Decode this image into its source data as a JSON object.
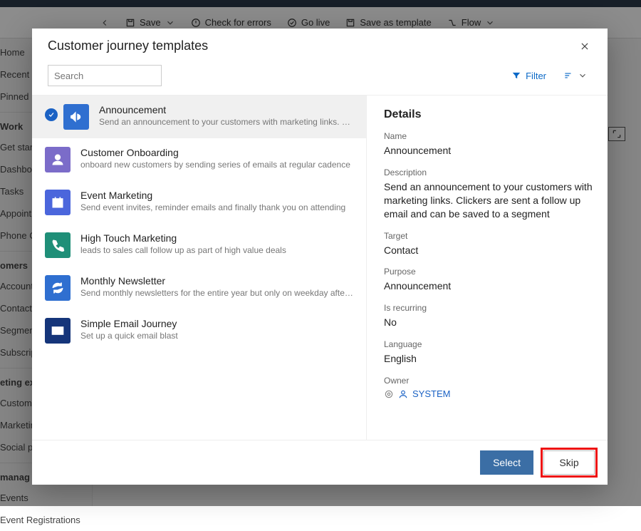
{
  "bg": {
    "cmd": {
      "save": "Save",
      "checkErrors": "Check for errors",
      "goLive": "Go live",
      "saveTemplate": "Save as template",
      "flow": "Flow"
    },
    "nav": {
      "home": "Home",
      "recent": "Recent",
      "pinned": "Pinned",
      "groupWork": "Work",
      "getStart": "Get start",
      "dashboard": "Dashboa",
      "tasks": "Tasks",
      "appoint": "Appoint",
      "phone": "Phone C",
      "groupCustomers": "omers",
      "accounts": "Account",
      "contacts": "Contacts",
      "segments": "Segmen",
      "subscrip": "Subscrip",
      "groupMarketingEx": "eting ex",
      "customer": "Custome",
      "marketin": "Marketin",
      "socialpo": "Social po",
      "groupManage": "manag",
      "events": "Events",
      "eventreg": "Event Registrations"
    }
  },
  "modal": {
    "title": "Customer journey templates",
    "searchPlaceholder": "Search",
    "filterLabel": "Filter",
    "details": {
      "heading": "Details",
      "nameLabel": "Name",
      "name": "Announcement",
      "descLabel": "Description",
      "desc": "Send an announcement to your customers with marketing links. Clickers are sent a follow up email and can be saved to a segment",
      "targetLabel": "Target",
      "target": "Contact",
      "purposeLabel": "Purpose",
      "purpose": "Announcement",
      "recurringLabel": "Is recurring",
      "recurring": "No",
      "languageLabel": "Language",
      "language": "English",
      "ownerLabel": "Owner",
      "owner": "SYSTEM"
    },
    "templates": [
      {
        "title": "Announcement",
        "desc": "Send an announcement to your customers with marketing links. Clickers are sent a…",
        "color": "#2f6fd0",
        "icon": "megaphone",
        "selected": true
      },
      {
        "title": "Customer Onboarding",
        "desc": "onboard new customers by sending series of emails at regular cadence",
        "color": "#7b6cc9",
        "icon": "person"
      },
      {
        "title": "Event Marketing",
        "desc": "Send event invites, reminder emails and finally thank you on attending",
        "color": "#4b66dc",
        "icon": "calendar"
      },
      {
        "title": "High Touch Marketing",
        "desc": "leads to sales call follow up as part of high value deals",
        "color": "#1f8f78",
        "icon": "phone"
      },
      {
        "title": "Monthly Newsletter",
        "desc": "Send monthly newsletters for the entire year but only on weekday afternoons",
        "color": "#2f6fd0",
        "icon": "refresh"
      },
      {
        "title": "Simple Email Journey",
        "desc": "Set up a quick email blast",
        "color": "#15357a",
        "icon": "mail"
      }
    ],
    "buttons": {
      "select": "Select",
      "skip": "Skip"
    }
  }
}
